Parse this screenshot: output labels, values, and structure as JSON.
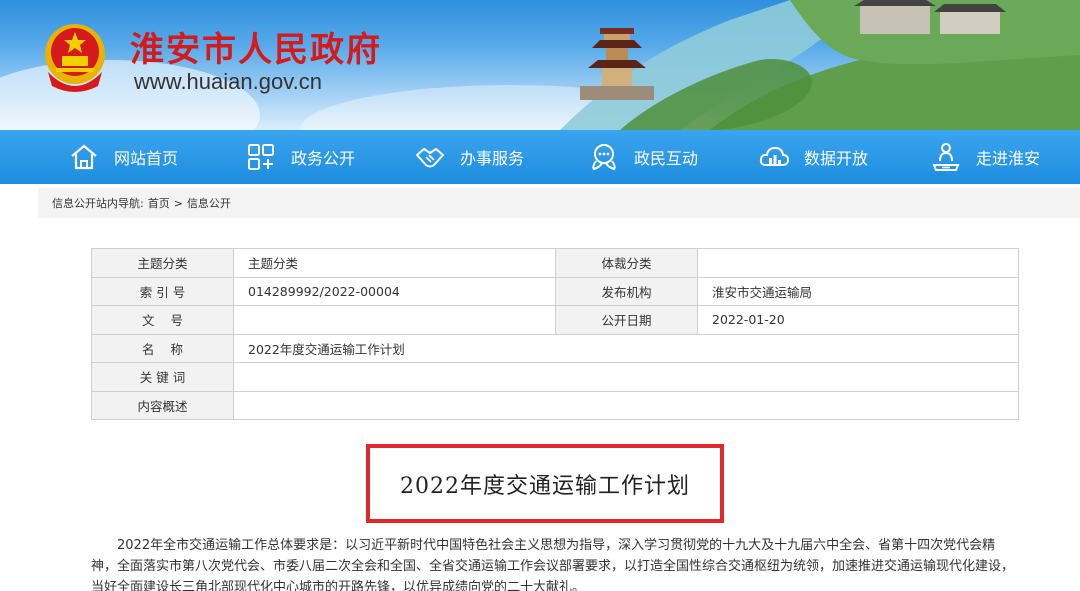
{
  "header": {
    "site_name": "淮安市人民政府",
    "site_url": "www.huaian.gov.cn",
    "brand_color": "#d6191b"
  },
  "nav": {
    "items": [
      {
        "label": "网站首页",
        "icon": "home-icon"
      },
      {
        "label": "政务公开",
        "icon": "grid-icon"
      },
      {
        "label": "办事服务",
        "icon": "handshake-icon"
      },
      {
        "label": "政民互动",
        "icon": "chat-icon"
      },
      {
        "label": "数据开放",
        "icon": "cloud-data-icon"
      },
      {
        "label": "走进淮安",
        "icon": "location-person-icon"
      }
    ],
    "color": "#1e8ddf"
  },
  "breadcrumb": {
    "prefix": "信息公开站内导航:",
    "home": "首页",
    "separator": ">",
    "current": "信息公开"
  },
  "info": {
    "topic_label": "主题分类",
    "topic_value": "主题分类",
    "genre_label": "体裁分类",
    "genre_value": "",
    "index_label": "索 引 号",
    "index_value": "014289992/2022-00004",
    "publisher_label": "发布机构",
    "publisher_value": "淮安市交通运输局",
    "docno_label": "文    号",
    "docno_value": "",
    "date_label": "公开日期",
    "date_value": "2022-01-20",
    "name_label": "名    称",
    "name_value": "2022年度交通运输工作计划",
    "keywords_label": "关 键 词",
    "keywords_value": "",
    "summary_label": "内容概述",
    "summary_value": ""
  },
  "article": {
    "title": "2022年度交通运输工作计划",
    "paragraph": "2022年全市交通运输工作总体要求是：以习近平新时代中国特色社会主义思想为指导，深入学习贯彻党的十九大及十九届六中全会、省第十四次党代会精神，全面落实市第八次党代会、市委八届二次全会和全国、全省交通运输工作会议部署要求，以打造全国性综合交通枢纽为统领，加速推进交通运输现代化建设，当好全面建设长三角北部现代化中心城市的开路先锋，以优异成绩向党的二十大献礼。"
  }
}
